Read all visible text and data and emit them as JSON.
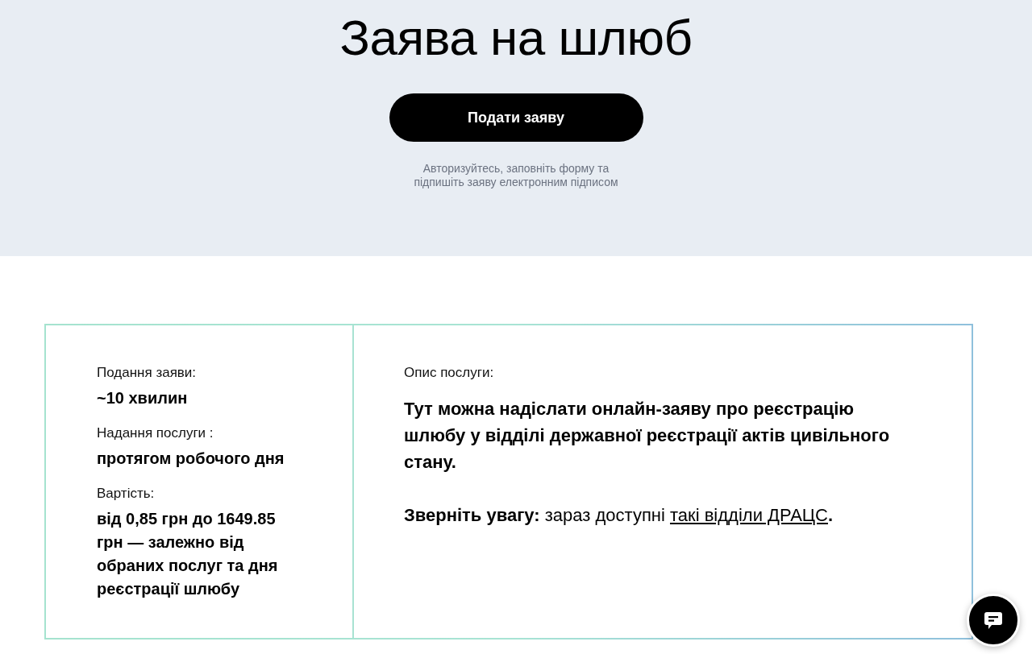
{
  "hero": {
    "title": "Заява на шлюб",
    "button": "Подати заяву",
    "hint": "Авторизуйтесь, заповніть форму та підпишіть заяву електронним підписом"
  },
  "details": [
    {
      "label": "Подання заяви:",
      "value": "~10 хвилин"
    },
    {
      "label": "Надання послуги :",
      "value": "протягом робочого дня"
    },
    {
      "label": "Вартість:",
      "value": "від 0,85 грн до 1649.85 грн — залежно від обраних послуг та дня реєстрації шлюбу"
    }
  ],
  "description": {
    "label": "Опис послуги:",
    "text": "Тут можна надіслати онлайн-заяву про реєстрацію шлюбу у відділі державної реєстрації актів цивільного стану.",
    "notice": {
      "text": "**Зверніть увагу:** зараз доступні",
      "link": "такі відділи ДРАЦС",
      "end": "**.**"
    }
  }
}
